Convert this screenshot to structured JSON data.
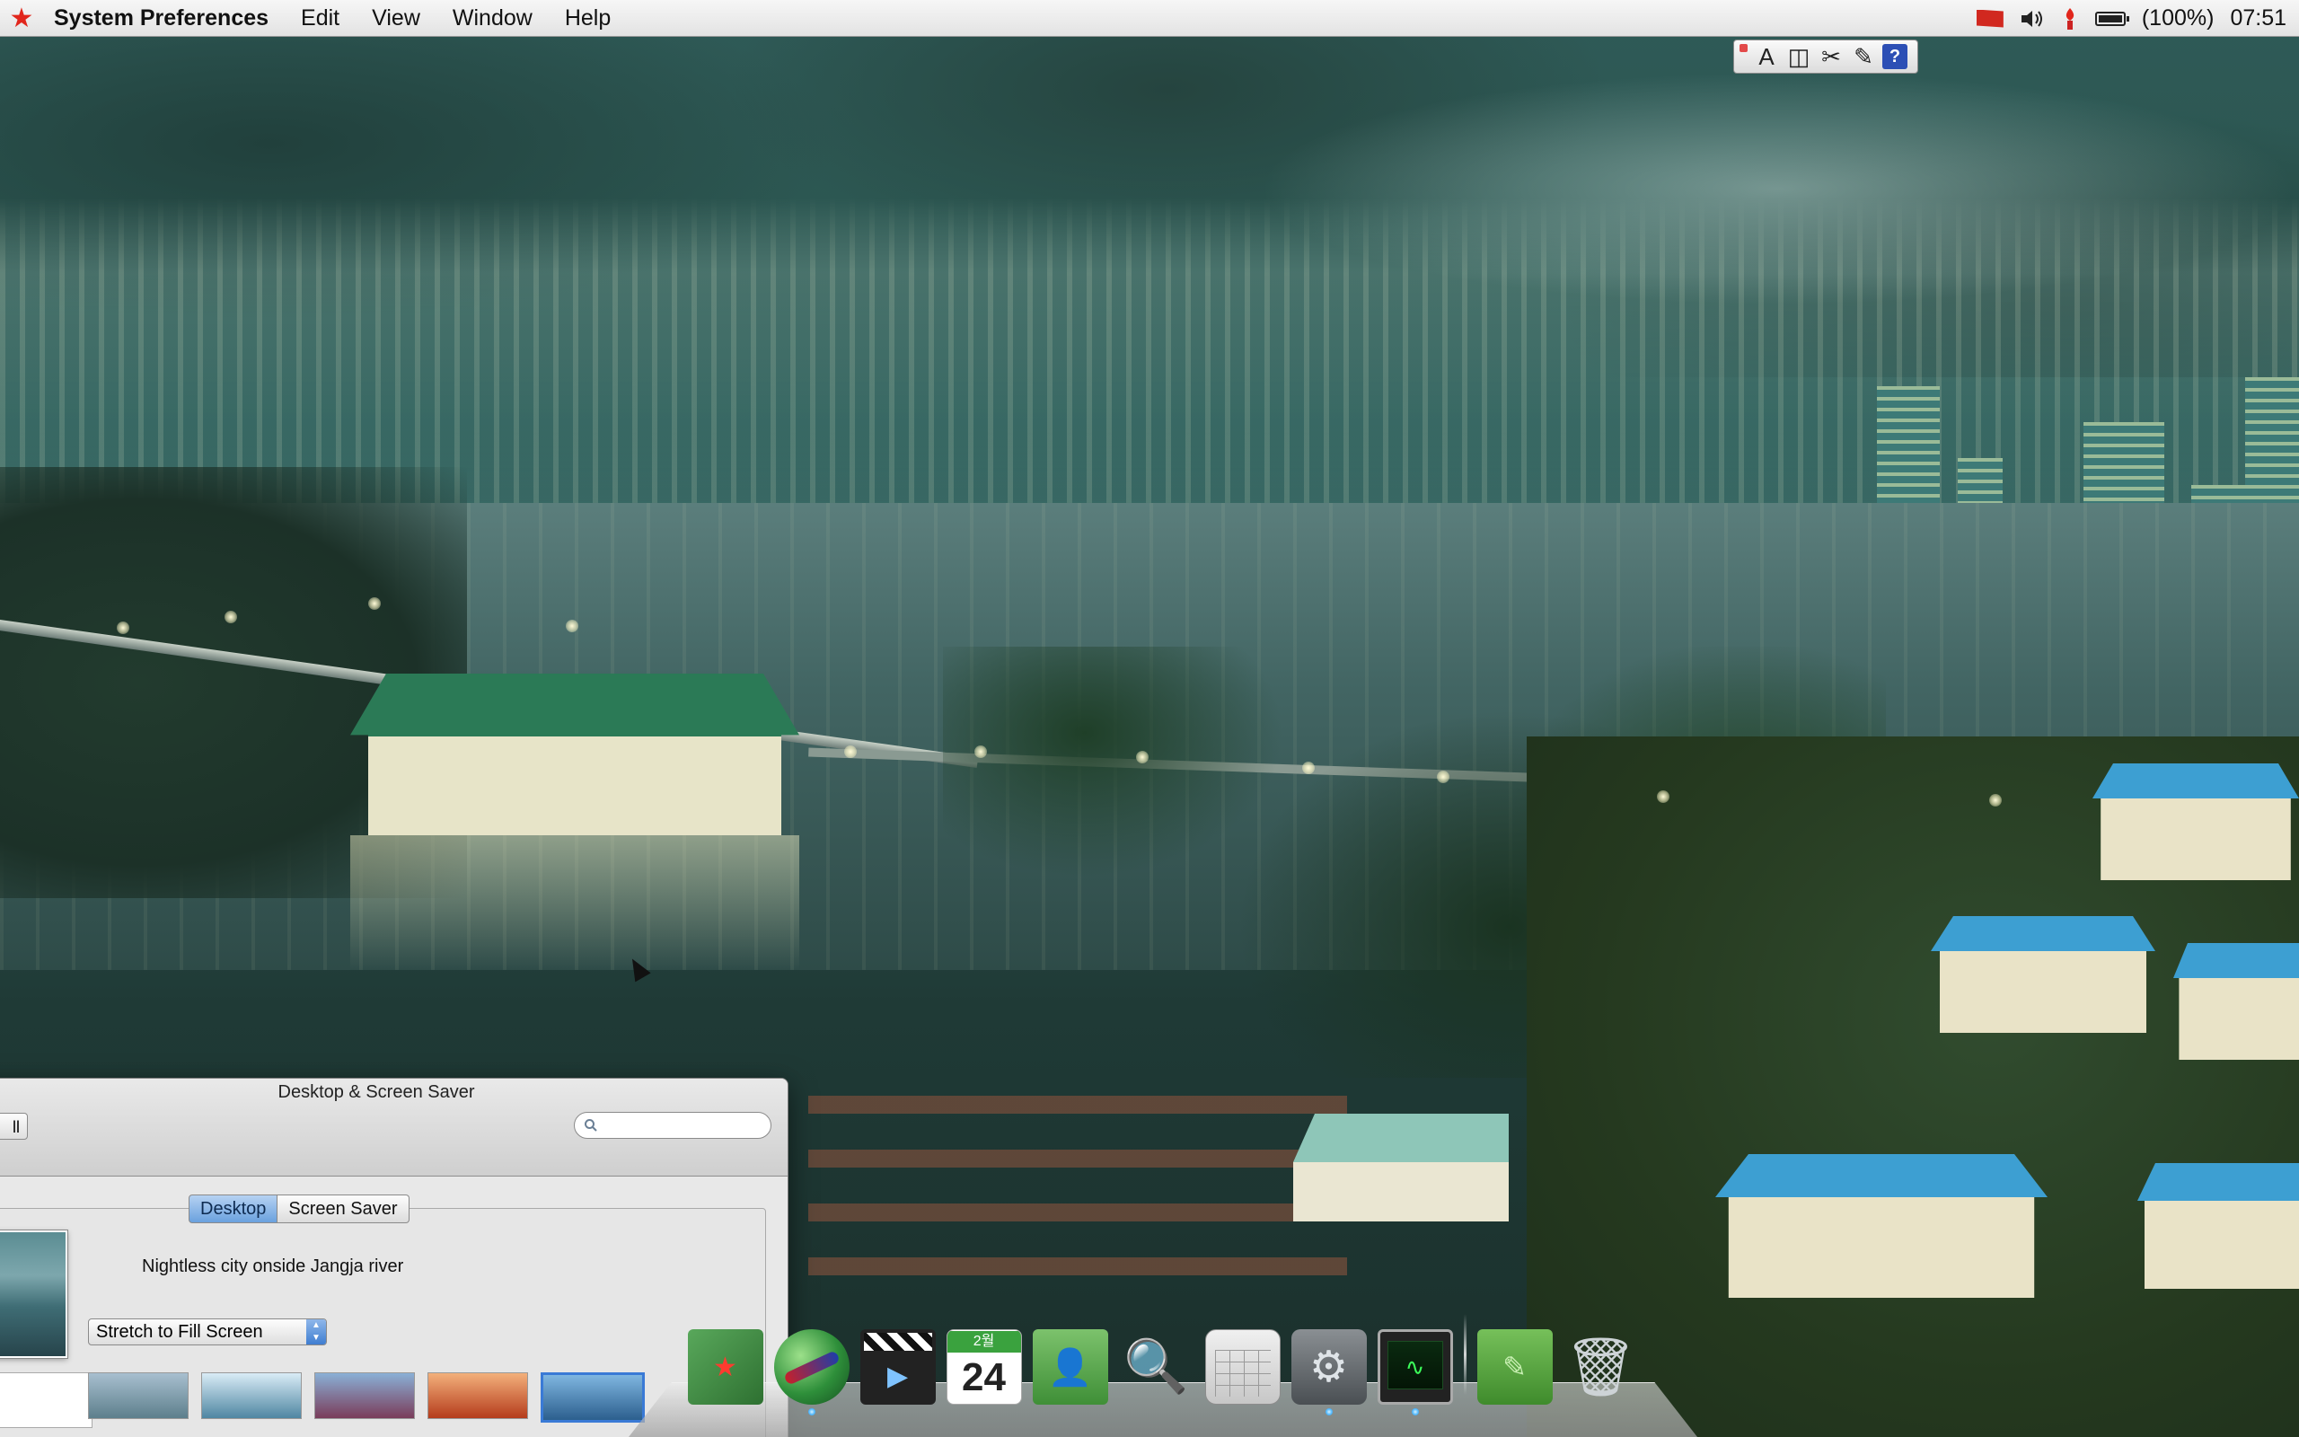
{
  "menubar": {
    "app_name": "System Preferences",
    "menus": [
      "Edit",
      "View",
      "Window",
      "Help"
    ],
    "status": {
      "flag_icon": "dprk-flag-icon",
      "volume_icon": "speaker-icon",
      "notification_icon": "torch-icon",
      "battery_icon": "battery-icon",
      "battery_text": "(100%)",
      "battery_level": 1.0,
      "clock": "07:51"
    },
    "accent_color": "#e1261c"
  },
  "input_palette": {
    "buttons": [
      {
        "name": "font-icon",
        "glyph": "A"
      },
      {
        "name": "panels-icon",
        "glyph": "◫"
      },
      {
        "name": "character-icon",
        "glyph": "✂"
      },
      {
        "name": "tools-icon",
        "glyph": "✎"
      },
      {
        "name": "help-icon",
        "glyph": "?"
      }
    ]
  },
  "prefs_window": {
    "title": "Desktop & Screen Saver",
    "show_all_label": "ll",
    "search_placeholder": "",
    "tabs": [
      {
        "label": "Desktop",
        "active": true
      },
      {
        "label": "Screen Saver",
        "active": false
      }
    ],
    "picture_name": "Nightless city onside Jangja river",
    "fit_option": "Stretch to Fill Screen"
  },
  "dock": {
    "items": [
      {
        "name": "dock-item-book",
        "icon": "red-star-book-icon",
        "running": false
      },
      {
        "name": "dock-item-browser",
        "icon": "globe-icon",
        "running": true
      },
      {
        "name": "dock-item-movie",
        "icon": "clapperboard-icon",
        "running": false
      },
      {
        "name": "dock-item-calendar",
        "icon": "calendar-icon",
        "running": false,
        "month": "2월",
        "day": "24"
      },
      {
        "name": "dock-item-contacts",
        "icon": "address-book-icon",
        "running": false
      },
      {
        "name": "dock-item-preview",
        "icon": "magnifier-photos-icon",
        "running": false
      },
      {
        "name": "dock-item-calculator",
        "icon": "calculator-icon",
        "running": false
      },
      {
        "name": "dock-item-system-preferences",
        "icon": "gear-tools-icon",
        "running": true
      },
      {
        "name": "dock-item-activity-monitor",
        "icon": "activity-monitor-icon",
        "running": true
      },
      {
        "name": "dock-item-documents",
        "icon": "folder-icon",
        "running": false
      },
      {
        "name": "dock-item-trash",
        "icon": "trash-icon",
        "running": false
      }
    ]
  },
  "desktop": {
    "wallpaper_colors": {
      "sky": "#2f5a57",
      "water": "#426563",
      "roof_blue": "#3d9fd2",
      "pavilion_green": "#2b7a56"
    }
  }
}
